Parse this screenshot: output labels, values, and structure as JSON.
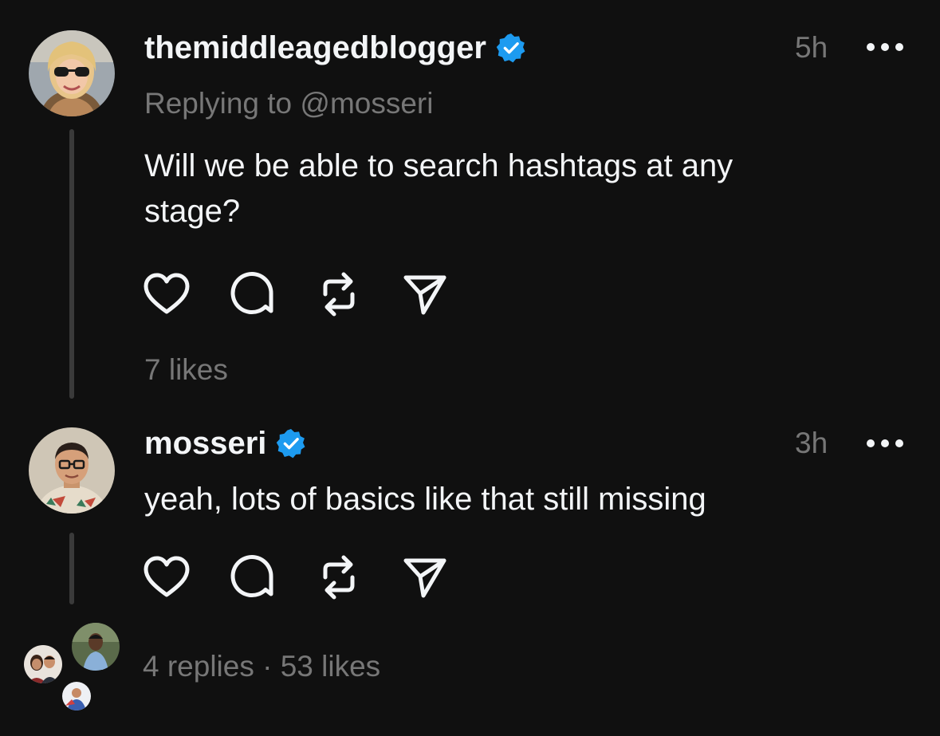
{
  "colors": {
    "background": "#101010",
    "text_primary": "#f3f5f7",
    "text_secondary": "#777777",
    "verified_blue": "#1d9bf0",
    "thread_line": "#3a3a3a"
  },
  "posts": [
    {
      "username": "themiddleagedblogger",
      "verified": true,
      "time": "5h",
      "reply_to": "Replying to @mosseri",
      "text": "Will we be able to search hashtags at any stage?",
      "actions": [
        "heart-icon",
        "comment-icon",
        "repost-icon",
        "share-icon"
      ],
      "likes": "7 likes"
    },
    {
      "username": "mosseri",
      "verified": true,
      "time": "3h",
      "text": "yeah, lots of basics like that still missing",
      "actions": [
        "heart-icon",
        "comment-icon",
        "repost-icon",
        "share-icon"
      ],
      "stats": "4 replies · 53 likes"
    }
  ]
}
